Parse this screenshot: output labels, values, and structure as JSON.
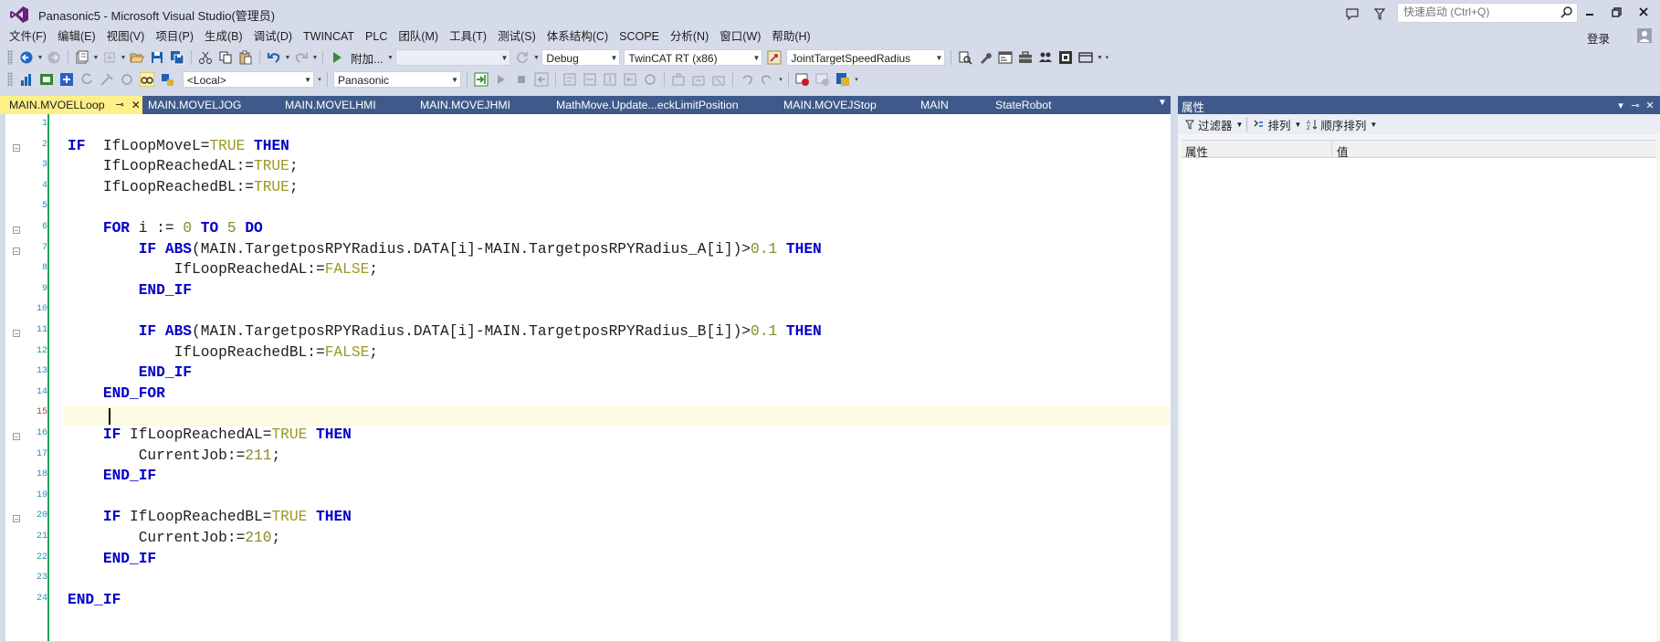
{
  "window": {
    "title": "Panasonic5 - Microsoft Visual Studio(管理员)",
    "quick_launch_placeholder": "快速启动 (Ctrl+Q)",
    "sign_in": "登录"
  },
  "menu": [
    "文件(F)",
    "编辑(E)",
    "视图(V)",
    "项目(P)",
    "生成(B)",
    "调试(D)",
    "TWINCAT",
    "PLC",
    "团队(M)",
    "工具(T)",
    "测试(S)",
    "体系结构(C)",
    "SCOPE",
    "分析(N)",
    "窗口(W)",
    "帮助(H)"
  ],
  "toolbar1": {
    "attach_label": "附加...",
    "config_combo": "Debug",
    "platform_combo": "TwinCAT RT (x86)",
    "target_combo": "JointTargetSpeedRadius"
  },
  "toolbar2": {
    "local_combo": "<Local>",
    "project_combo": "Panasonic"
  },
  "tabs": [
    {
      "label": "MAIN.MVOELLoop",
      "active": true
    },
    {
      "label": "MAIN.MOVELJOG",
      "active": false
    },
    {
      "label": "MAIN.MOVELHMI",
      "active": false
    },
    {
      "label": "MAIN.MOVEJHMI",
      "active": false
    },
    {
      "label": "MathMove.Update...eckLimitPosition",
      "active": false
    },
    {
      "label": "MAIN.MOVEJStop",
      "active": false
    },
    {
      "label": "MAIN",
      "active": false
    },
    {
      "label": "StateRobot",
      "active": false
    }
  ],
  "editor": {
    "current_line": 15,
    "lines": [
      {
        "n": "1",
        "indent": 0,
        "tokens": []
      },
      {
        "n": "2",
        "indent": 0,
        "fold": true,
        "tokens": [
          [
            "kw",
            "IF"
          ],
          [
            "var",
            "  IfLoopMoveL="
          ],
          [
            "lit",
            "TRUE"
          ],
          [
            "var",
            " "
          ],
          [
            "kw",
            "THEN"
          ]
        ]
      },
      {
        "n": "3",
        "indent": 1,
        "tokens": [
          [
            "var",
            "IfLoopReachedAL:="
          ],
          [
            "lit",
            "TRUE"
          ],
          [
            "var",
            ";"
          ]
        ]
      },
      {
        "n": "4",
        "indent": 1,
        "tokens": [
          [
            "var",
            "IfLoopReachedBL:="
          ],
          [
            "lit",
            "TRUE"
          ],
          [
            "var",
            ";"
          ]
        ]
      },
      {
        "n": "5",
        "indent": 0,
        "tokens": []
      },
      {
        "n": "6",
        "indent": 1,
        "fold": true,
        "tokens": [
          [
            "kw",
            "FOR"
          ],
          [
            "var",
            " i := "
          ],
          [
            "num",
            "0"
          ],
          [
            "var",
            " "
          ],
          [
            "kw",
            "TO"
          ],
          [
            "var",
            " "
          ],
          [
            "num",
            "5"
          ],
          [
            "var",
            " "
          ],
          [
            "kw",
            "DO"
          ]
        ]
      },
      {
        "n": "7",
        "indent": 2,
        "fold": true,
        "tokens": [
          [
            "kw",
            "IF"
          ],
          [
            "var",
            " "
          ],
          [
            "kw",
            "ABS"
          ],
          [
            "var",
            "(MAIN.TargetposRPYRadius.DATA[i]-MAIN.TargetposRPYRadius_A[i])>"
          ],
          [
            "num",
            "0.1"
          ],
          [
            "var",
            " "
          ],
          [
            "kw",
            "THEN"
          ]
        ]
      },
      {
        "n": "8",
        "indent": 3,
        "tokens": [
          [
            "var",
            "IfLoopReachedAL:="
          ],
          [
            "lit",
            "FALSE"
          ],
          [
            "var",
            ";"
          ]
        ]
      },
      {
        "n": "9",
        "indent": 2,
        "tokens": [
          [
            "kw",
            "END_IF"
          ]
        ]
      },
      {
        "n": "10",
        "indent": 0,
        "tokens": []
      },
      {
        "n": "11",
        "indent": 2,
        "fold": true,
        "tokens": [
          [
            "kw",
            "IF"
          ],
          [
            "var",
            " "
          ],
          [
            "kw",
            "ABS"
          ],
          [
            "var",
            "(MAIN.TargetposRPYRadius.DATA[i]-MAIN.TargetposRPYRadius_B[i])>"
          ],
          [
            "num",
            "0.1"
          ],
          [
            "var",
            " "
          ],
          [
            "kw",
            "THEN"
          ]
        ]
      },
      {
        "n": "12",
        "indent": 3,
        "tokens": [
          [
            "var",
            "IfLoopReachedBL:="
          ],
          [
            "lit",
            "FALSE"
          ],
          [
            "var",
            ";"
          ]
        ]
      },
      {
        "n": "13",
        "indent": 2,
        "tokens": [
          [
            "kw",
            "END_IF"
          ]
        ]
      },
      {
        "n": "14",
        "indent": 1,
        "tokens": [
          [
            "kw",
            "END_FOR"
          ]
        ]
      },
      {
        "n": "15",
        "indent": 0,
        "tokens": []
      },
      {
        "n": "16",
        "indent": 1,
        "fold": true,
        "tokens": [
          [
            "kw",
            "IF"
          ],
          [
            "var",
            " IfLoopReachedAL="
          ],
          [
            "lit",
            "TRUE"
          ],
          [
            "var",
            " "
          ],
          [
            "kw",
            "THEN"
          ]
        ]
      },
      {
        "n": "17",
        "indent": 2,
        "tokens": [
          [
            "var",
            "CurrentJob:="
          ],
          [
            "num",
            "211"
          ],
          [
            "var",
            ";"
          ]
        ]
      },
      {
        "n": "18",
        "indent": 1,
        "tokens": [
          [
            "kw",
            "END_IF"
          ]
        ]
      },
      {
        "n": "19",
        "indent": 0,
        "tokens": []
      },
      {
        "n": "20",
        "indent": 1,
        "fold": true,
        "tokens": [
          [
            "kw",
            "IF"
          ],
          [
            "var",
            " IfLoopReachedBL="
          ],
          [
            "lit",
            "TRUE"
          ],
          [
            "var",
            " "
          ],
          [
            "kw",
            "THEN"
          ]
        ]
      },
      {
        "n": "21",
        "indent": 2,
        "tokens": [
          [
            "var",
            "CurrentJob:="
          ],
          [
            "num",
            "210"
          ],
          [
            "var",
            ";"
          ]
        ]
      },
      {
        "n": "22",
        "indent": 1,
        "tokens": [
          [
            "kw",
            "END_IF"
          ]
        ]
      },
      {
        "n": "23",
        "indent": 0,
        "tokens": []
      },
      {
        "n": "24",
        "indent": 0,
        "tokens": [
          [
            "kw",
            "END_IF"
          ]
        ]
      }
    ]
  },
  "properties": {
    "title": "属性",
    "filter_label": "过滤器",
    "sort_label": "排列",
    "order_label": "顺序排列",
    "col_name": "属性",
    "col_value": "值"
  }
}
